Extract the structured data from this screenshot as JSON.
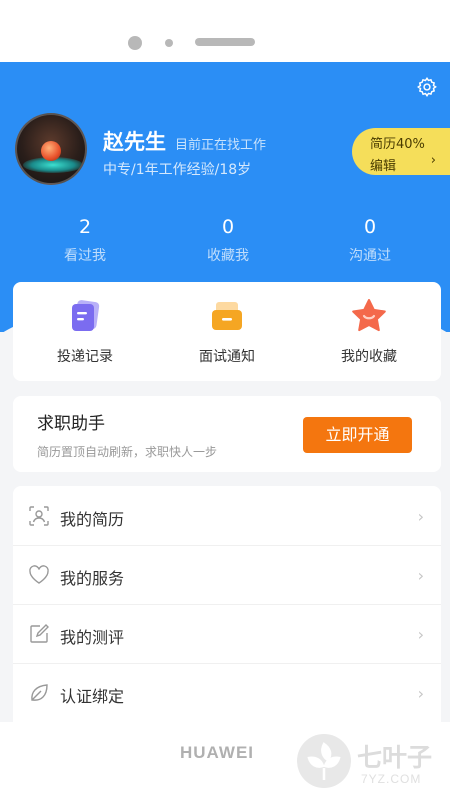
{
  "profile": {
    "name": "赵先生",
    "status": "目前正在找工作",
    "info": "中专/1年工作经验/18岁",
    "resume_badge": {
      "percent_label": "简历40%",
      "edit_label": "编辑",
      "arrow": "›"
    }
  },
  "stats": [
    {
      "value": "2",
      "label": "看过我"
    },
    {
      "value": "0",
      "label": "收藏我"
    },
    {
      "value": "0",
      "label": "沟通过"
    }
  ],
  "quick_actions": [
    {
      "label": "投递记录",
      "icon": "document-icon",
      "color": "#7b6cf0"
    },
    {
      "label": "面试通知",
      "icon": "envelope-icon",
      "color": "#f5a623"
    },
    {
      "label": "我的收藏",
      "icon": "star-icon",
      "color": "#f4694b"
    }
  ],
  "helper": {
    "title": "求职助手",
    "desc": "简历置顶自动刷新，求职快人一步",
    "button": "立即开通"
  },
  "menu": [
    {
      "label": "我的简历",
      "icon": "resume-scan-icon"
    },
    {
      "label": "我的服务",
      "icon": "heart-icon"
    },
    {
      "label": "我的测评",
      "icon": "edit-icon"
    },
    {
      "label": "认证绑定",
      "icon": "leaf-icon"
    }
  ],
  "chevron": "›",
  "device": {
    "brand": "HUAWEI"
  },
  "watermark": {
    "text": "七叶子",
    "sub": "7YZ.COM"
  },
  "colors": {
    "header": "#2b8ef5",
    "badge": "#f5de5a",
    "button": "#f4760f"
  }
}
